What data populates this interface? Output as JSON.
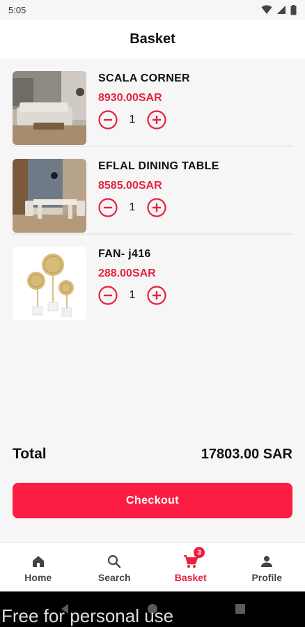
{
  "status_bar": {
    "time": "5:05"
  },
  "header": {
    "title": "Basket"
  },
  "items": [
    {
      "name": "SCALA CORNER",
      "price": "8930.00SAR",
      "quantity": "1",
      "image": "sofa-photo"
    },
    {
      "name": "EFLAL DINING TABLE",
      "price": "8585.00SAR",
      "quantity": "1",
      "image": "dining-table-photo"
    },
    {
      "name": "FAN- j416",
      "price": "288.00SAR",
      "quantity": "1",
      "image": "decor-sculpture-photo"
    }
  ],
  "summary": {
    "total_label": "Total",
    "total_value": "17803.00 SAR"
  },
  "checkout": {
    "label": "Checkout"
  },
  "bottom_nav": {
    "items": [
      {
        "label": "Home",
        "icon": "home-icon"
      },
      {
        "label": "Search",
        "icon": "search-icon"
      },
      {
        "label": "Basket",
        "icon": "cart-icon",
        "badge": "3",
        "active": true
      },
      {
        "label": "Profile",
        "icon": "person-icon"
      }
    ]
  },
  "watermark": {
    "text": "Free for personal use"
  },
  "colors": {
    "accent": "#fb1d44",
    "price": "#e8213f",
    "background": "#f6f6f6"
  }
}
